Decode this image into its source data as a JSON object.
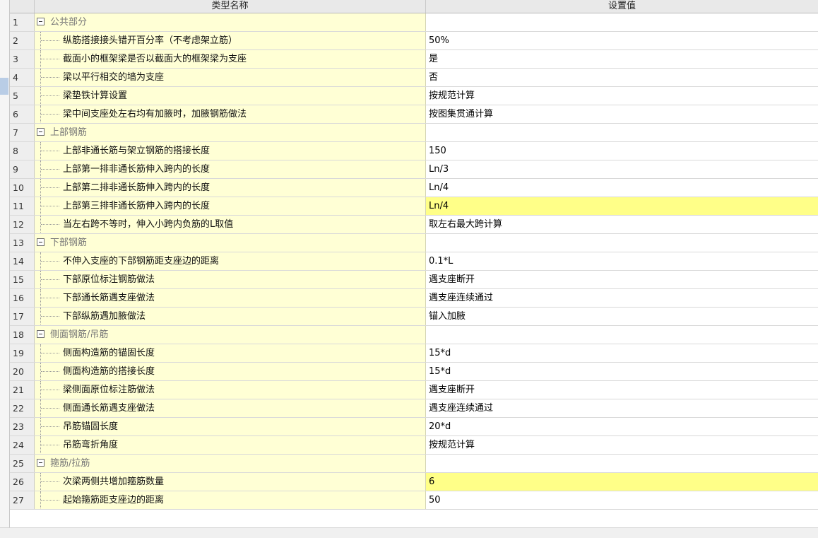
{
  "header": {
    "name_col": "类型名称",
    "value_col": "设置值"
  },
  "rows": [
    {
      "num": "1",
      "type": "group",
      "label": "公共部分",
      "value": ""
    },
    {
      "num": "2",
      "type": "item",
      "label": "纵筋搭接接头错开百分率（不考虑架立筋）",
      "value": "50%"
    },
    {
      "num": "3",
      "type": "item",
      "label": "截面小的框架梁是否以截面大的框架梁为支座",
      "value": "是"
    },
    {
      "num": "4",
      "type": "item",
      "label": "梁以平行相交的墙为支座",
      "value": "否"
    },
    {
      "num": "5",
      "type": "item",
      "label": "梁垫铁计算设置",
      "value": "按规范计算"
    },
    {
      "num": "6",
      "type": "item",
      "label": "梁中间支座处左右均有加腋时，加腋钢筋做法",
      "value": "按图集贯通计算"
    },
    {
      "num": "7",
      "type": "group",
      "label": "上部钢筋",
      "value": ""
    },
    {
      "num": "8",
      "type": "item",
      "label": "上部非通长筋与架立钢筋的搭接长度",
      "value": "150"
    },
    {
      "num": "9",
      "type": "item",
      "label": "上部第一排非通长筋伸入跨内的长度",
      "value": "Ln/3"
    },
    {
      "num": "10",
      "type": "item",
      "label": "上部第二排非通长筋伸入跨内的长度",
      "value": "Ln/4"
    },
    {
      "num": "11",
      "type": "item",
      "label": "上部第三排非通长筋伸入跨内的长度",
      "value": "Ln/4",
      "highlight": true
    },
    {
      "num": "12",
      "type": "item",
      "label": "当左右跨不等时，伸入小跨内负筋的L取值",
      "value": "取左右最大跨计算"
    },
    {
      "num": "13",
      "type": "group",
      "label": "下部钢筋",
      "value": ""
    },
    {
      "num": "14",
      "type": "item",
      "label": "不伸入支座的下部钢筋距支座边的距离",
      "value": "0.1*L"
    },
    {
      "num": "15",
      "type": "item",
      "label": "下部原位标注钢筋做法",
      "value": "遇支座断开"
    },
    {
      "num": "16",
      "type": "item",
      "label": "下部通长筋遇支座做法",
      "value": "遇支座连续通过"
    },
    {
      "num": "17",
      "type": "item",
      "label": "下部纵筋遇加腋做法",
      "value": "锚入加腋"
    },
    {
      "num": "18",
      "type": "group",
      "label": "侧面钢筋/吊筋",
      "value": ""
    },
    {
      "num": "19",
      "type": "item",
      "label": "侧面构造筋的锚固长度",
      "value": "15*d"
    },
    {
      "num": "20",
      "type": "item",
      "label": "侧面构造筋的搭接长度",
      "value": "15*d"
    },
    {
      "num": "21",
      "type": "item",
      "label": "梁侧面原位标注筋做法",
      "value": "遇支座断开"
    },
    {
      "num": "22",
      "type": "item",
      "label": "侧面通长筋遇支座做法",
      "value": "遇支座连续通过"
    },
    {
      "num": "23",
      "type": "item",
      "label": "吊筋锚固长度",
      "value": "20*d"
    },
    {
      "num": "24",
      "type": "item",
      "label": "吊筋弯折角度",
      "value": "按规范计算"
    },
    {
      "num": "25",
      "type": "group",
      "label": "箍筋/拉筋",
      "value": ""
    },
    {
      "num": "26",
      "type": "item",
      "label": "次梁两侧共增加箍筋数量",
      "value": "6",
      "highlight": true
    },
    {
      "num": "27",
      "type": "item",
      "label": "起始箍筋距支座边的距离",
      "value": "50"
    }
  ],
  "colors": {
    "name_cell_bg": "#ffffd5",
    "highlight_bg": "#ffff88",
    "header_bg": "#e9e9e9"
  }
}
